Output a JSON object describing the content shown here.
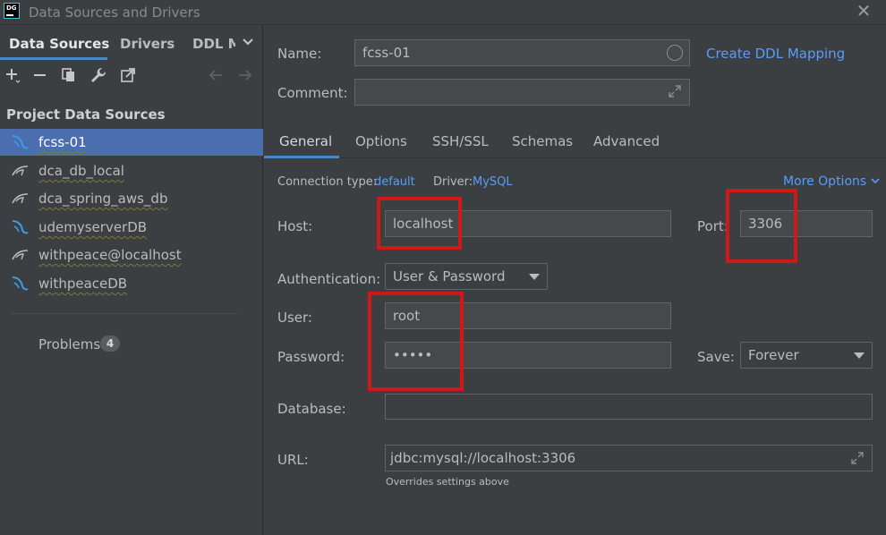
{
  "window": {
    "title": "Data Sources and Drivers",
    "app_icon_text": "DG"
  },
  "sidebar": {
    "tabs": [
      {
        "label": "Data Sources",
        "active": true
      },
      {
        "label": "Drivers",
        "active": false
      },
      {
        "label": "DDL M",
        "active": false
      }
    ],
    "toolbar_icons": [
      "add-icon",
      "remove-icon",
      "duplicate-icon",
      "wrench-icon",
      "jump-icon",
      "back-arrow-icon",
      "forward-arrow-icon"
    ],
    "section_title": "Project Data Sources",
    "items": [
      {
        "label": "fcss-01",
        "selected": true,
        "icon": "mysql-icon"
      },
      {
        "label": "dca_db_local",
        "selected": false,
        "icon": "db-icon"
      },
      {
        "label": "dca_spring_aws_db",
        "selected": false,
        "icon": "db-icon"
      },
      {
        "label": "udemyserverDB",
        "selected": false,
        "icon": "mysql-icon"
      },
      {
        "label": "withpeace@localhost",
        "selected": false,
        "icon": "db-icon"
      },
      {
        "label": "withpeaceDB",
        "selected": false,
        "icon": "mysql-icon"
      }
    ],
    "problems_label": "Problems",
    "problems_count": "4"
  },
  "form": {
    "name_label": "Name:",
    "name_value": "fcss-01",
    "create_ddl_link": "Create DDL Mapping",
    "comment_label": "Comment:",
    "comment_value": "",
    "tabs": [
      "General",
      "Options",
      "SSH/SSL",
      "Schemas",
      "Advanced"
    ],
    "connection_type_label": "Connection type:",
    "connection_type_value": "default",
    "driver_label": "Driver:",
    "driver_value": "MySQL",
    "more_options": "More Options",
    "host_label": "Host:",
    "host_value": "localhost",
    "port_label": "Port:",
    "port_value": "3306",
    "auth_label": "Authentication:",
    "auth_value": "User & Password",
    "user_label": "User:",
    "user_value": "root",
    "password_label": "Password:",
    "password_value": "•••••",
    "save_label": "Save:",
    "save_value": "Forever",
    "database_label": "Database:",
    "database_value": "",
    "url_label": "URL:",
    "url_value": "jdbc:mysql://localhost:3306",
    "url_hint": "Overrides settings above"
  },
  "colors": {
    "accent": "#4a88c7",
    "link": "#589df6",
    "selection": "#4b6eaf",
    "highlight_box": "#d01818"
  }
}
